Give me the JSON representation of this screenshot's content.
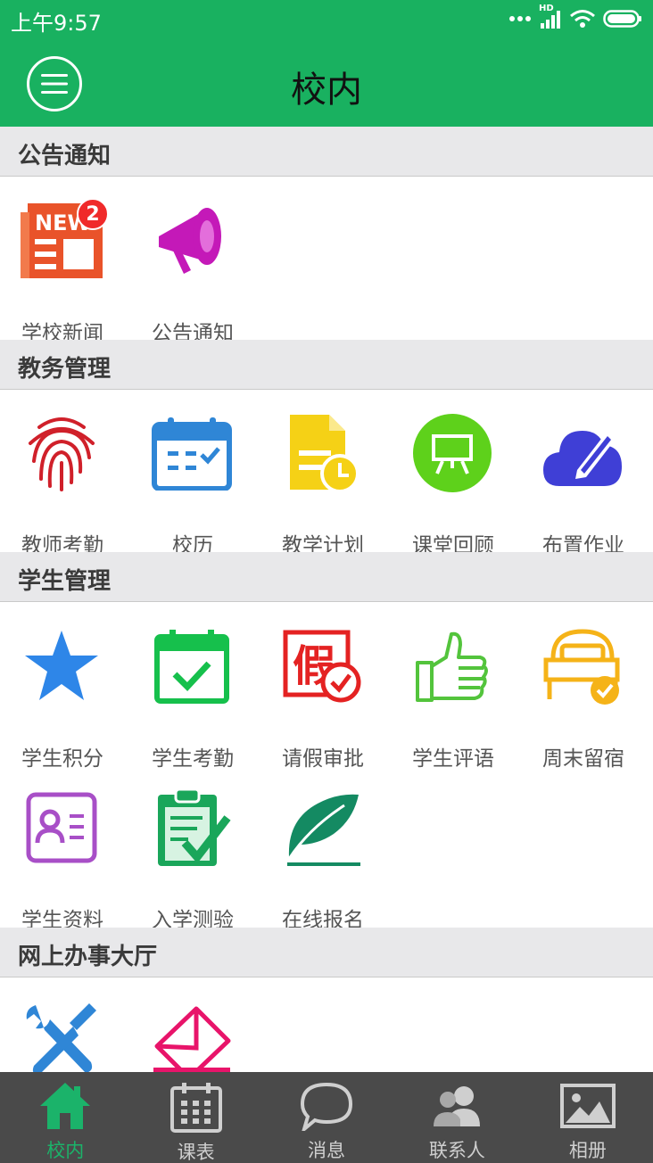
{
  "status": {
    "time": "上午9:57",
    "network_label": "HD"
  },
  "app_bar": {
    "title": "校内"
  },
  "sections": [
    {
      "title": "公告通知",
      "items": [
        {
          "label": "学校新闻",
          "icon": "news-icon",
          "badge": "2"
        },
        {
          "label": "公告通知",
          "icon": "megaphone-icon"
        }
      ]
    },
    {
      "title": "教务管理",
      "items": [
        {
          "label": "教师考勤",
          "icon": "fingerprint-icon"
        },
        {
          "label": "校历",
          "icon": "calendar-icon"
        },
        {
          "label": "教学计划",
          "icon": "plan-document-icon"
        },
        {
          "label": "课堂回顾",
          "icon": "board-icon"
        },
        {
          "label": "布置作业",
          "icon": "cloud-pencil-icon"
        }
      ]
    },
    {
      "title": "学生管理",
      "items": [
        {
          "label": "学生积分",
          "icon": "star-icon"
        },
        {
          "label": "学生考勤",
          "icon": "calendar-check-icon"
        },
        {
          "label": "请假审批",
          "icon": "leave-approval-icon"
        },
        {
          "label": "学生评语",
          "icon": "thumbs-up-icon"
        },
        {
          "label": "周末留宿",
          "icon": "bed-icon"
        },
        {
          "label": "学生资料",
          "icon": "id-card-icon"
        },
        {
          "label": "入学测验",
          "icon": "clipboard-check-icon"
        },
        {
          "label": "在线报名",
          "icon": "feather-icon"
        }
      ]
    },
    {
      "title": "网上办事大厅",
      "items": [
        {
          "label": "",
          "icon": "tools-icon"
        },
        {
          "label": "",
          "icon": "envelope-icon"
        }
      ]
    }
  ],
  "bottom_nav": [
    {
      "label": "校内",
      "icon": "home-icon",
      "active": true
    },
    {
      "label": "课表",
      "icon": "timetable-icon"
    },
    {
      "label": "消息",
      "icon": "chat-icon"
    },
    {
      "label": "联系人",
      "icon": "contacts-icon"
    },
    {
      "label": "相册",
      "icon": "album-icon"
    }
  ],
  "colors": {
    "brand": "#19b160",
    "section_bg": "#e8e8ea",
    "nav_bg": "#4a4a4a",
    "nav_active": "#1bb36a"
  }
}
